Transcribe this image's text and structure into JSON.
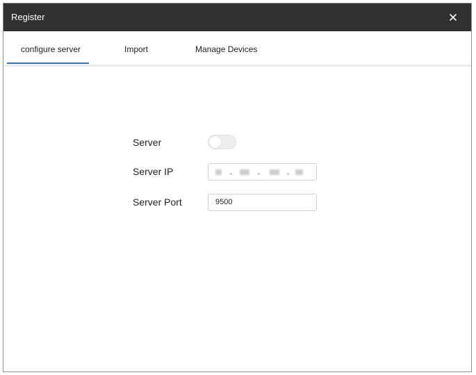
{
  "window": {
    "title": "Register",
    "close_icon": "close-icon"
  },
  "tabs": [
    {
      "label": "configure server",
      "active": true
    },
    {
      "label": "Import",
      "active": false
    },
    {
      "label": "Manage Devices",
      "active": false
    }
  ],
  "form": {
    "server_label": "Server",
    "server_toggle_on": false,
    "server_ip_label": "Server IP",
    "server_port_label": "Server Port",
    "server_port_value": "9500"
  },
  "colors": {
    "titlebar": "#303030",
    "tab_accent": "#2f71d8"
  }
}
